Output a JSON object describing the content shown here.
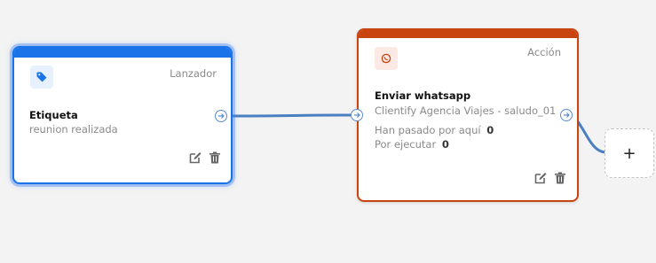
{
  "trigger_node": {
    "type_label": "Lanzador",
    "icon": "tag-icon",
    "title": "Etiqueta",
    "subtitle": "reunion realizada",
    "color": "#1a73e8"
  },
  "action_node": {
    "type_label": "Acción",
    "icon": "whatsapp-icon",
    "title": "Enviar whatsapp",
    "subtitle": "Clientify Agencia Viajes - saludo_01",
    "stats": [
      {
        "label": "Han pasado por aquí",
        "value": "0"
      },
      {
        "label": "Por ejecutar",
        "value": "0"
      }
    ],
    "color": "#c8450f"
  },
  "add_node": {
    "label": "+"
  },
  "colors": {
    "connector": "#4a7fc1",
    "canvas": "#f3f3f3"
  }
}
